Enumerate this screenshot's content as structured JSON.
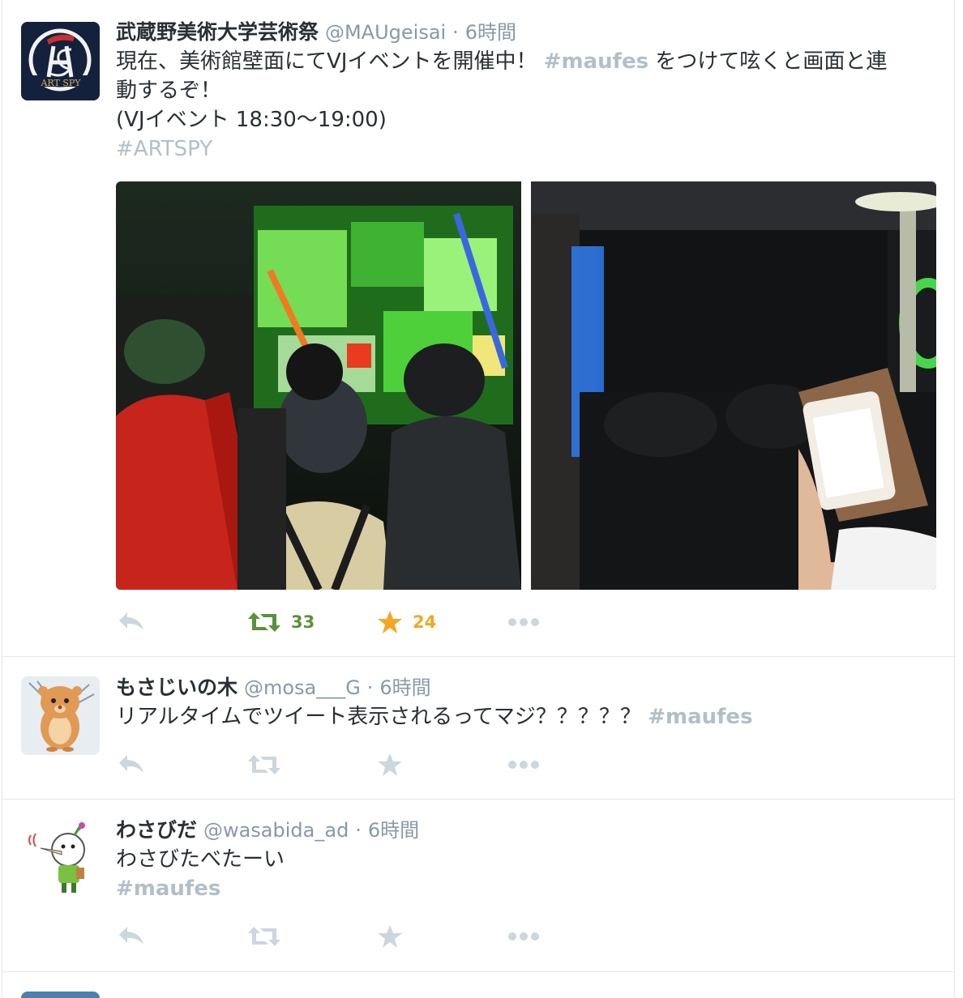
{
  "colors": {
    "muted": "#8899a6",
    "hashtag": "#b3bfc7",
    "retweeted": "#5c913b",
    "favorited": "#f5a623",
    "action_idle": "#ccd6dd"
  },
  "tweets": [
    {
      "avatar_icon": "artspy-logo-avatar",
      "avatar_logo_text": "ART SPY",
      "name": "武蔵野美術大学芸術祭",
      "handle": "@MAUgeisai",
      "dot": "·",
      "time": "6時間",
      "text_1": "現在、美術館壁面にてVJイベントを開催中！ ",
      "hashtag_1": "#maufes",
      "text_2": " をつけて呟くと画面と連\n動するぞ！\n(VJイベント 18:30〜19:00)\n",
      "hashtag_2": "#ARTSPY",
      "retweet_count": "33",
      "favorite_count": "24"
    },
    {
      "avatar_icon": "hamster-avatar",
      "name": "もさじいの木",
      "handle": "@mosa___G",
      "dot": "·",
      "time": "6時間",
      "text_1": "リアルタイムでツイート表示されるってマジ？？？？？ ",
      "hashtag_1": "#maufes"
    },
    {
      "avatar_icon": "wasabi-character-avatar",
      "name": "わさびだ",
      "handle": "@wasabida_ad",
      "dot": "·",
      "time": "6時間",
      "text_1": "わさびたべたーい\n",
      "hashtag_1": "#maufes"
    }
  ]
}
